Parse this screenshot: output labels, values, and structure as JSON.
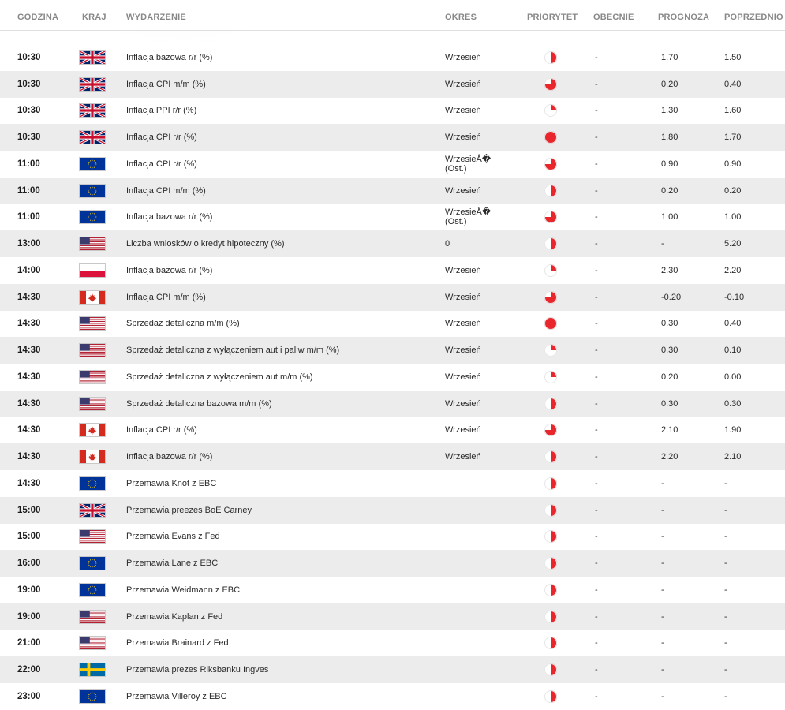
{
  "header": {
    "time": "GODZINA",
    "country": "KRAJ",
    "event": "WYDARZENIE",
    "period": "OKRES",
    "priority": "PRIORYTET",
    "actual": "OBECNIE",
    "forecast": "PROGNOZA",
    "previous": "POPRZEDNIO"
  },
  "colors": {
    "priority_red": "#e8262b",
    "row_alt": "#ececec",
    "header_text": "#888888"
  },
  "rows": [
    {
      "time": "10:30",
      "flag": "gb",
      "event": "Inflacja bazowa r/r (%)",
      "period": "Wrzesień",
      "priority": 0.5,
      "actual": "-",
      "forecast": "1.70",
      "previous": "1.50"
    },
    {
      "time": "10:30",
      "flag": "gb",
      "event": "Inflacja CPI m/m (%)",
      "period": "Wrzesień",
      "priority": 0.75,
      "actual": "-",
      "forecast": "0.20",
      "previous": "0.40"
    },
    {
      "time": "10:30",
      "flag": "gb",
      "event": "Inflacja PPI r/r (%)",
      "period": "Wrzesień",
      "priority": 0.25,
      "actual": "-",
      "forecast": "1.30",
      "previous": "1.60"
    },
    {
      "time": "10:30",
      "flag": "gb",
      "event": "Inflacja CPI r/r (%)",
      "period": "Wrzesień",
      "priority": 1,
      "actual": "-",
      "forecast": "1.80",
      "previous": "1.70"
    },
    {
      "time": "11:00",
      "flag": "eu",
      "event": "Inflacja CPI r/r (%)",
      "period": "WrzesieÅ�\n(Ost.)",
      "priority": 0.75,
      "actual": "-",
      "forecast": "0.90",
      "previous": "0.90"
    },
    {
      "time": "11:00",
      "flag": "eu",
      "event": "Inflacja CPI m/m (%)",
      "period": "Wrzesień",
      "priority": 0.5,
      "actual": "-",
      "forecast": "0.20",
      "previous": "0.20"
    },
    {
      "time": "11:00",
      "flag": "eu",
      "event": "Inflacja bazowa r/r (%)",
      "period": "WrzesieÅ�\n(Ost.)",
      "priority": 0.75,
      "actual": "-",
      "forecast": "1.00",
      "previous": "1.00"
    },
    {
      "time": "13:00",
      "flag": "us",
      "event": "Liczba wniosków o kredyt hipoteczny (%)",
      "period": "0",
      "priority": 0.5,
      "actual": "-",
      "forecast": "-",
      "previous": "5.20"
    },
    {
      "time": "14:00",
      "flag": "pl",
      "event": "Inflacja bazowa r/r (%)",
      "period": "Wrzesień",
      "priority": 0.25,
      "actual": "-",
      "forecast": "2.30",
      "previous": "2.20"
    },
    {
      "time": "14:30",
      "flag": "ca",
      "event": "Inflacja CPI m/m (%)",
      "period": "Wrzesień",
      "priority": 0.75,
      "actual": "-",
      "forecast": "-0.20",
      "previous": "-0.10"
    },
    {
      "time": "14:30",
      "flag": "us",
      "event": "Sprzedaż detaliczna m/m (%)",
      "period": "Wrzesień",
      "priority": 1,
      "actual": "-",
      "forecast": "0.30",
      "previous": "0.40"
    },
    {
      "time": "14:30",
      "flag": "us",
      "event": "Sprzedaż detaliczna z wyłączeniem aut i paliw m/m (%)",
      "period": "Wrzesień",
      "priority": 0.25,
      "actual": "-",
      "forecast": "0.30",
      "previous": "0.10"
    },
    {
      "time": "14:30",
      "flag": "us",
      "event": "Sprzedaż detaliczna z wyłączeniem aut m/m (%)",
      "period": "Wrzesień",
      "priority": 0.25,
      "actual": "-",
      "forecast": "0.20",
      "previous": "0.00"
    },
    {
      "time": "14:30",
      "flag": "us",
      "event": "Sprzedaż detaliczna bazowa m/m (%)",
      "period": "Wrzesień",
      "priority": 0.5,
      "actual": "-",
      "forecast": "0.30",
      "previous": "0.30"
    },
    {
      "time": "14:30",
      "flag": "ca",
      "event": "Inflacja CPI r/r (%)",
      "period": "Wrzesień",
      "priority": 0.75,
      "actual": "-",
      "forecast": "2.10",
      "previous": "1.90"
    },
    {
      "time": "14:30",
      "flag": "ca",
      "event": "Inflacja bazowa r/r (%)",
      "period": "Wrzesień",
      "priority": 0.5,
      "actual": "-",
      "forecast": "2.20",
      "previous": "2.10"
    },
    {
      "time": "14:30",
      "flag": "eu",
      "event": "Przemawia Knot z EBC",
      "period": "",
      "priority": 0.5,
      "actual": "-",
      "forecast": "-",
      "previous": "-"
    },
    {
      "time": "15:00",
      "flag": "gb",
      "event": "Przemawia preezes BoE Carney",
      "period": "",
      "priority": 0.5,
      "actual": "-",
      "forecast": "-",
      "previous": "-"
    },
    {
      "time": "15:00",
      "flag": "us",
      "event": "Przemawia Evans z Fed",
      "period": "",
      "priority": 0.5,
      "actual": "-",
      "forecast": "-",
      "previous": "-"
    },
    {
      "time": "16:00",
      "flag": "eu",
      "event": "Przemawia Lane z EBC",
      "period": "",
      "priority": 0.5,
      "actual": "-",
      "forecast": "-",
      "previous": "-"
    },
    {
      "time": "19:00",
      "flag": "eu",
      "event": "Przemawia Weidmann z EBC",
      "period": "",
      "priority": 0.5,
      "actual": "-",
      "forecast": "-",
      "previous": "-"
    },
    {
      "time": "19:00",
      "flag": "us",
      "event": "Przemawia Kaplan z Fed",
      "period": "",
      "priority": 0.5,
      "actual": "-",
      "forecast": "-",
      "previous": "-"
    },
    {
      "time": "21:00",
      "flag": "us",
      "event": "Przemawia Brainard z Fed",
      "period": "",
      "priority": 0.5,
      "actual": "-",
      "forecast": "-",
      "previous": "-"
    },
    {
      "time": "22:00",
      "flag": "se",
      "event": "Przemawia prezes Riksbanku Ingves",
      "period": "",
      "priority": 0.5,
      "actual": "-",
      "forecast": "-",
      "previous": "-"
    },
    {
      "time": "23:00",
      "flag": "eu",
      "event": "Przemawia Villeroy z EBC",
      "period": "",
      "priority": 0.5,
      "actual": "-",
      "forecast": "-",
      "previous": "-"
    }
  ]
}
